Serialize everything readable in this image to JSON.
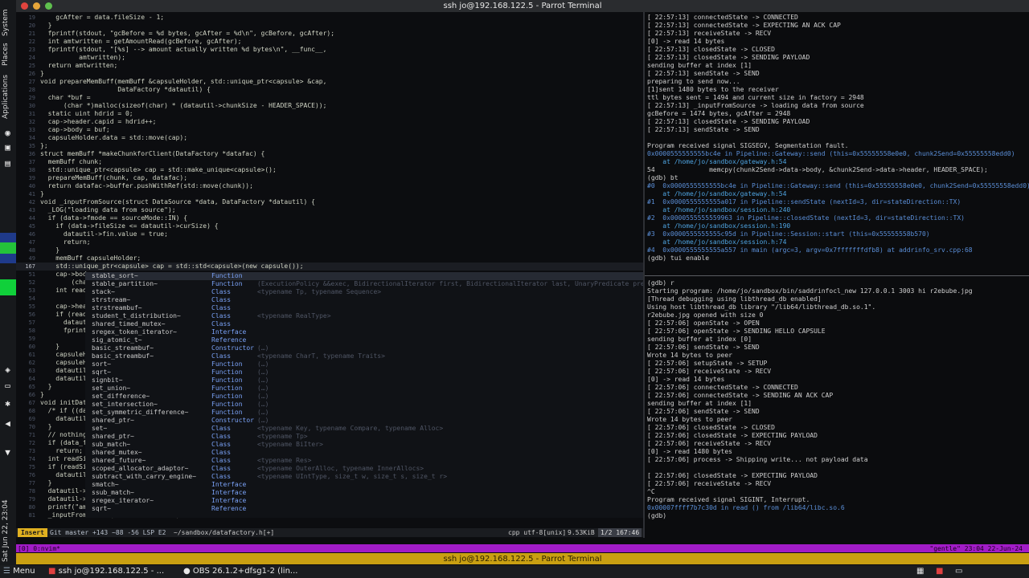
{
  "window": {
    "title": "ssh jo@192.168.122.5 - Parrot Terminal",
    "traffic_colors": [
      "#e0443e",
      "#e6a53a",
      "#5fc04e"
    ]
  },
  "side_panel": {
    "menus": [
      "Applications",
      "Places",
      "System"
    ],
    "clock": "Sat Jun 22, 23:04"
  },
  "editor": {
    "lines": [
      {
        "n": "19",
        "t": "    gcAfter = data.fileSize - 1;"
      },
      {
        "n": "20",
        "t": "  }"
      },
      {
        "n": "21",
        "t": "  fprintf(stdout, \"gcBefore = %d bytes, gcAfter = %d\\n\", gcBefore, gcAfter);"
      },
      {
        "n": "22",
        "t": "  int amtwritten = getAmountRead(gcBefore, gcAfter);"
      },
      {
        "n": "23",
        "t": "  fprintf(stdout, \"[%s] --> amount actually written %d bytes\\n\", __func__,"
      },
      {
        "n": "24",
        "t": "          amtwritten);"
      },
      {
        "n": "25",
        "t": "  return amtwritten;"
      },
      {
        "n": "26",
        "t": "}"
      },
      {
        "n": "27",
        "t": "void prepareMemBuff(memBuff &capsuleHolder, std::unique_ptr<capsule> &cap,"
      },
      {
        "n": "28",
        "t": "                    DataFactory *datautil) {"
      },
      {
        "n": "29",
        "t": "  char *buf ="
      },
      {
        "n": "30",
        "t": "      (char *)malloc(sizeof(char) * (datautil->chunkSize - HEADER_SPACE));"
      },
      {
        "n": "31",
        "t": "  static uint hdrid = 0;"
      },
      {
        "n": "32",
        "t": "  cap->header.capid = hdrid++;"
      },
      {
        "n": "33",
        "t": "  cap->body = buf;"
      },
      {
        "n": "34",
        "t": "  capsuleHolder.data = std::move(cap);"
      },
      {
        "n": "35",
        "t": "};"
      },
      {
        "n": "36",
        "t": "struct memBuff *makeChunkforClient(DataFactory *datafac) {"
      },
      {
        "n": "37",
        "t": "  memBuff chunk;"
      },
      {
        "n": "38",
        "t": "  std::unique_ptr<capsule> cap = std::make_unique<capsule>();"
      },
      {
        "n": "39",
        "t": "  prepareMemBuff(chunk, cap, datafac);"
      },
      {
        "n": "40",
        "t": "  return datafac->buffer.pushWithRef(std::move(chunk));"
      },
      {
        "n": "41",
        "t": "}"
      },
      {
        "n": "42",
        "t": "void _inputFromSource(struct DataSource *data, DataFactory *datautil) {"
      },
      {
        "n": "43",
        "t": "  _LOG(\"loading data from source\");"
      },
      {
        "n": "44",
        "t": "  if (data->fmode == sourceMode::IN) {"
      },
      {
        "n": "45",
        "t": "    if (data->fileSize <= datautil->curSize) {"
      },
      {
        "n": "46",
        "t": "      datautil->fin.value = true;"
      },
      {
        "n": "47",
        "t": "      return;"
      },
      {
        "n": "48",
        "t": "    }"
      },
      {
        "n": "49",
        "t": "    memBuff capsuleHolder;"
      },
      {
        "n": "167",
        "t": "    std::unique_ptr<capsule> cap = std::std<capsule>(new capsule());"
      },
      {
        "n": "51",
        "t": "    cap->body"
      },
      {
        "n": "52",
        "t": "        (char"
      },
      {
        "n": "53",
        "t": "    int readSi"
      },
      {
        "n": "54",
        "t": ""
      },
      {
        "n": "55",
        "t": "    cap->heade"
      },
      {
        "n": "56",
        "t": "    if (readSi"
      },
      {
        "n": "57",
        "t": "      datautil"
      },
      {
        "n": "58",
        "t": "      fprintf("
      },
      {
        "n": "59",
        "t": ""
      },
      {
        "n": "60",
        "t": "    }"
      },
      {
        "n": "61",
        "t": "    capsuleHol"
      },
      {
        "n": "62",
        "t": "    capsuleHol"
      },
      {
        "n": "63",
        "t": "    datautil->"
      },
      {
        "n": "64",
        "t": "    datautil->"
      },
      {
        "n": "65",
        "t": "  }"
      },
      {
        "n": "66",
        "t": "}"
      },
      {
        "n": "67",
        "t": "void initDataS"
      },
      {
        "n": "68",
        "t": "  /* if ((data"
      },
      {
        "n": "69",
        "t": "    datautil->"
      },
      {
        "n": "70",
        "t": "  }"
      },
      {
        "n": "71",
        "t": "  // nothing t"
      },
      {
        "n": "72",
        "t": "  if (data_fmo"
      },
      {
        "n": "73",
        "t": "    return;"
      },
      {
        "n": "74",
        "t": "  int readSize"
      },
      {
        "n": "75",
        "t": "  if (readSize"
      },
      {
        "n": "76",
        "t": "    datautil->"
      },
      {
        "n": "77",
        "t": "  }"
      },
      {
        "n": "78",
        "t": "  datautil->cu"
      },
      {
        "n": "79",
        "t": "  datautil->cu"
      },
      {
        "n": "80",
        "t": "  printf(\"amou"
      },
      {
        "n": "81",
        "t": "  _inputFromSource(sourceData, this);"
      }
    ],
    "completion": [
      {
        "name": "stable_sort~",
        "kind": "Function",
        "detail": ""
      },
      {
        "name": "stable_partition~",
        "kind": "Function",
        "detail": "(ExecutionPolicy &&exec, BidirectionalIterator first, BidirectionalIterator last, UnaryPredicate pred)"
      },
      {
        "name": "stack~",
        "kind": "Class",
        "detail": "<typename Tp, typename Sequence>"
      },
      {
        "name": "strstream~",
        "kind": "Class",
        "detail": ""
      },
      {
        "name": "strstreambuf~",
        "kind": "Class",
        "detail": ""
      },
      {
        "name": "student_t_distribution~",
        "kind": "Class",
        "detail": "<typename RealType>"
      },
      {
        "name": "shared_timed_mutex~",
        "kind": "Class",
        "detail": ""
      },
      {
        "name": "sregex_token_iterator~",
        "kind": "Interface",
        "detail": ""
      },
      {
        "name": "sig_atomic_t~",
        "kind": "Reference",
        "detail": ""
      },
      {
        "name": "basic_streambuf~",
        "kind": "Constructor",
        "detail": "(…)"
      },
      {
        "name": "basic_streambuf~",
        "kind": "Class",
        "detail": "<typename CharT, typename Traits>"
      },
      {
        "name": "sort~",
        "kind": "Function",
        "detail": "(…)"
      },
      {
        "name": "sqrt~",
        "kind": "Function",
        "detail": "(…)"
      },
      {
        "name": "signbit~",
        "kind": "Function",
        "detail": "(…)"
      },
      {
        "name": "set_union~",
        "kind": "Function",
        "detail": "(…)"
      },
      {
        "name": "set_difference~",
        "kind": "Function",
        "detail": "(…)"
      },
      {
        "name": "set_intersection~",
        "kind": "Function",
        "detail": "(…)"
      },
      {
        "name": "set_symmetric_difference~",
        "kind": "Function",
        "detail": "(…)"
      },
      {
        "name": "shared_ptr~",
        "kind": "Constructor",
        "detail": "(…)"
      },
      {
        "name": "set~",
        "kind": "Class",
        "detail": "<typename Key, typename Compare, typename Alloc>"
      },
      {
        "name": "shared_ptr~",
        "kind": "Class",
        "detail": "<typename Tp>"
      },
      {
        "name": "sub_match~",
        "kind": "Class",
        "detail": "<typename BiIter>"
      },
      {
        "name": "shared_mutex~",
        "kind": "Class",
        "detail": ""
      },
      {
        "name": "shared_future~",
        "kind": "Class",
        "detail": "<typename Res>"
      },
      {
        "name": "scoped_allocator_adaptor~",
        "kind": "Class",
        "detail": "<typename OuterAlloc, typename InnerAllocs>"
      },
      {
        "name": "subtract_with_carry_engine~",
        "kind": "Class",
        "detail": "<typename UIntType, size_t w, size_t s, size_t r>"
      },
      {
        "name": "smatch~",
        "kind": "Interface",
        "detail": ""
      },
      {
        "name": "ssub_match~",
        "kind": "Interface",
        "detail": ""
      },
      {
        "name": "sregex_iterator~",
        "kind": "Interface",
        "detail": ""
      },
      {
        "name": "sqrt~",
        "kind": "Reference",
        "detail": ""
      }
    ],
    "status": {
      "mode": "Insert",
      "git": "Git master +143 ~88 -56 LSP E2",
      "file": "~/sandbox/datafactory.h[+]",
      "ft": "cpp utf-8[unix]",
      "size": "9.53KiB",
      "pos": "1/2 167:46"
    }
  },
  "gdb_top": [
    "[ 22:57:13] connectedState -> CONNECTED",
    "[ 22:57:13] connectedState -> EXPECTING AN ACK CAP",
    "[ 22:57:13] receiveState -> RECV",
    "[0] -> read 14 bytes",
    "[ 22:57:13] closedState -> CLOSED",
    "[ 22:57:13] closedState -> SENDING PAYLOAD",
    "sending buffer at index [1]",
    "[ 22:57:13] sendState -> SEND",
    "preparing to send now...",
    "[1]sent 1480 bytes to the receiver",
    "ttl bytes sent = 1494 and current size in factory = 2948",
    "[ 22:57:13] _inputFromSource -> loading data from source",
    "gcBefore = 1474 bytes, gcAfter = 2948",
    "[ 22:57:13] closedState -> SENDING PAYLOAD",
    "[ 22:57:13] sendState -> SEND",
    "",
    "Program received signal SIGSEGV, Segmentation fault.",
    "0x0000555555555bc4e in Pipeline::Gateway::send (this=0x55555558e0e0, chunk2Send=0x55555558edd0)",
    "    at /home/jo/sandbox/gateway.h:54",
    "54              memcpy(chunk2Send->data->body, &chunk2Send->data->header, HEADER_SPACE);",
    "(gdb) bt",
    "#0  0x0000555555555bc4e in Pipeline::Gateway::send (this=0x55555558e0e0, chunk2Send=0x55555558edd0)",
    "    at /home/jo/sandbox/gateway.h:54",
    "#1  0x0000555555555a017 in Pipeline::sendState (nextId=3, dir=stateDirection::TX)",
    "    at /home/jo/sandbox/session.h:240",
    "#2  0x0000555555559963 in Pipeline::closedState (nextId=3, dir=stateDirection::TX)",
    "    at /home/jo/sandbox/session.h:190",
    "#3  0x0000555555555c95d in Pipeline::Session::start (this=0x55555558b570)",
    "    at /home/jo/sandbox/session.h:74",
    "#4  0x0000555555555a557 in main (argc=3, argv=0x7fffffffdfb8) at addrinfo_srv.cpp:68",
    "(gdb) tui enable"
  ],
  "gdb_bottom": [
    "(gdb) r",
    "Starting program: /home/jo/sandbox/bin/saddrinfocl_new 127.0.0.1 3003 hi r2ebube.jpg",
    "[Thread debugging using libthread_db enabled]",
    "Using host libthread_db library \"/lib64/libthread_db.so.1\".",
    "r2ebube.jpg opened with size 0",
    "[ 22:57:06] openState -> OPEN",
    "[ 22:57:06] openState -> SENDING HELLO CAPSULE",
    "sending buffer at index [0]",
    "[ 22:57:06] sendState -> SEND",
    "Wrote 14 bytes to peer",
    "[ 22:57:06] setupState -> SETUP",
    "[ 22:57:06] receiveState -> RECV",
    "[0] -> read 14 bytes",
    "[ 22:57:06] connectedState -> CONNECTED",
    "[ 22:57:06] connectedState -> SENDING AN ACK CAP",
    "sending buffer at index [1]",
    "[ 22:57:06] sendState -> SEND",
    "Wrote 14 bytes to peer",
    "[ 22:57:06] closedState -> CLOSED",
    "[ 22:57:06] closedState -> EXPECTING PAYLOAD",
    "[ 22:57:06] receiveState -> RECV",
    "[0] -> read 1480 bytes",
    "[ 22:57:06] process -> Shipping write... not payload data",
    "",
    "[ 22:57:06] closedState -> EXPECTING PAYLOAD",
    "[ 22:57:06] receiveState -> RECV",
    "^C",
    "Program received signal SIGINT, Interrupt.",
    "0x00007ffff7b7c30d in read () from /lib64/libc.so.6",
    "(gdb)"
  ],
  "tmux": {
    "left": "[0] 0:nvim*",
    "right": "\"gentle\" 23:04 22-Jun-24"
  },
  "title2": "ssh jo@192.168.122.5 - Parrot Terminal",
  "taskbar": {
    "menu": "Menu",
    "item1": "ssh jo@192.168.122.5 - ...",
    "item2": "OBS 26.1.2+dfsg1-2 (lin..."
  },
  "colors": {
    "tmux_bar": "#a21cc7",
    "title_strip": "#c9a012",
    "insert_mode": "#e0b020",
    "line_number": "#4d5566"
  }
}
